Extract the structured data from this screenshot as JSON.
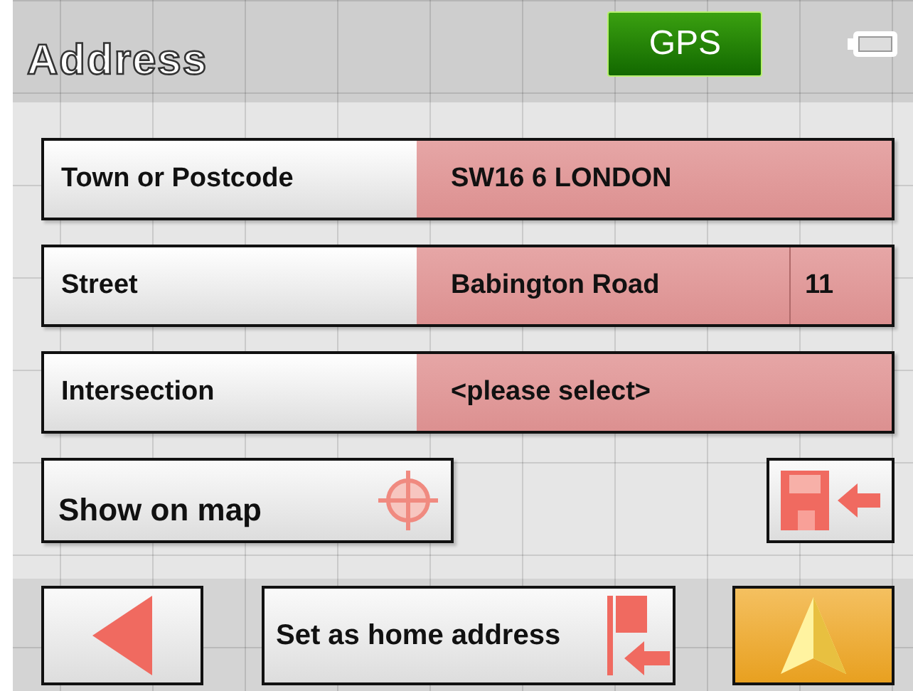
{
  "header": {
    "title": "Address",
    "gps_badge": "GPS"
  },
  "fields": [
    {
      "kind": "single",
      "label": "Town or Postcode",
      "value": "SW16 6 LONDON"
    },
    {
      "kind": "split",
      "label": "Street",
      "value": "Babington Road",
      "number": "11"
    },
    {
      "kind": "single",
      "label": "Intersection",
      "value": "<please select>"
    }
  ],
  "show_on_map": {
    "label": "Show on map"
  },
  "bottom_bar": {
    "home_button": "Set as home address"
  }
}
